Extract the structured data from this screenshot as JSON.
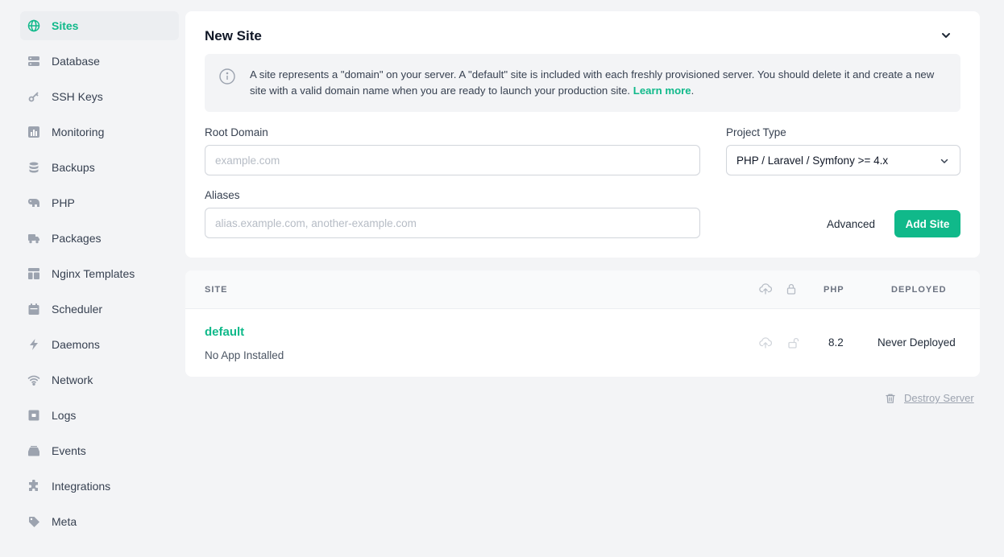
{
  "sidebar": {
    "items": [
      {
        "label": "Sites",
        "icon": "globe-icon",
        "active": true
      },
      {
        "label": "Database",
        "icon": "database-icon"
      },
      {
        "label": "SSH Keys",
        "icon": "key-icon"
      },
      {
        "label": "Monitoring",
        "icon": "chart-bar-icon"
      },
      {
        "label": "Backups",
        "icon": "stack-icon"
      },
      {
        "label": "PHP",
        "icon": "elephant-icon"
      },
      {
        "label": "Packages",
        "icon": "truck-icon"
      },
      {
        "label": "Nginx Templates",
        "icon": "template-icon"
      },
      {
        "label": "Scheduler",
        "icon": "calendar-icon"
      },
      {
        "label": "Daemons",
        "icon": "bolt-icon"
      },
      {
        "label": "Network",
        "icon": "wifi-icon"
      },
      {
        "label": "Logs",
        "icon": "archive-icon"
      },
      {
        "label": "Events",
        "icon": "inbox-icon"
      },
      {
        "label": "Integrations",
        "icon": "puzzle-icon"
      },
      {
        "label": "Meta",
        "icon": "tag-icon"
      }
    ]
  },
  "new_site": {
    "title": "New Site",
    "info_text": "A site represents a \"domain\" on your server. A \"default\" site is included with each freshly provisioned server. You should delete it and create a new site with a valid domain name when you are ready to launch your production site.",
    "learn_more": "Learn more",
    "info_period": ".",
    "root_domain_label": "Root Domain",
    "root_domain_placeholder": "example.com",
    "root_domain_value": "",
    "project_type_label": "Project Type",
    "project_type_value": "PHP / Laravel / Symfony >= 4.x",
    "aliases_label": "Aliases",
    "aliases_placeholder": "alias.example.com, another-example.com",
    "aliases_value": "",
    "advanced_label": "Advanced",
    "add_label": "Add Site"
  },
  "sites_table": {
    "headers": {
      "site": "SITE",
      "php": "PHP",
      "deployed": "DEPLOYED"
    },
    "header_icons": [
      "cloud-upload-icon",
      "lock-icon"
    ],
    "rows": [
      {
        "name": "default",
        "status": "No App Installed",
        "php": "8.2",
        "deployed": "Never Deployed"
      }
    ]
  },
  "destroy_label": "Destroy Server",
  "colors": {
    "accent": "#10b98a",
    "background": "#f3f4f6"
  }
}
